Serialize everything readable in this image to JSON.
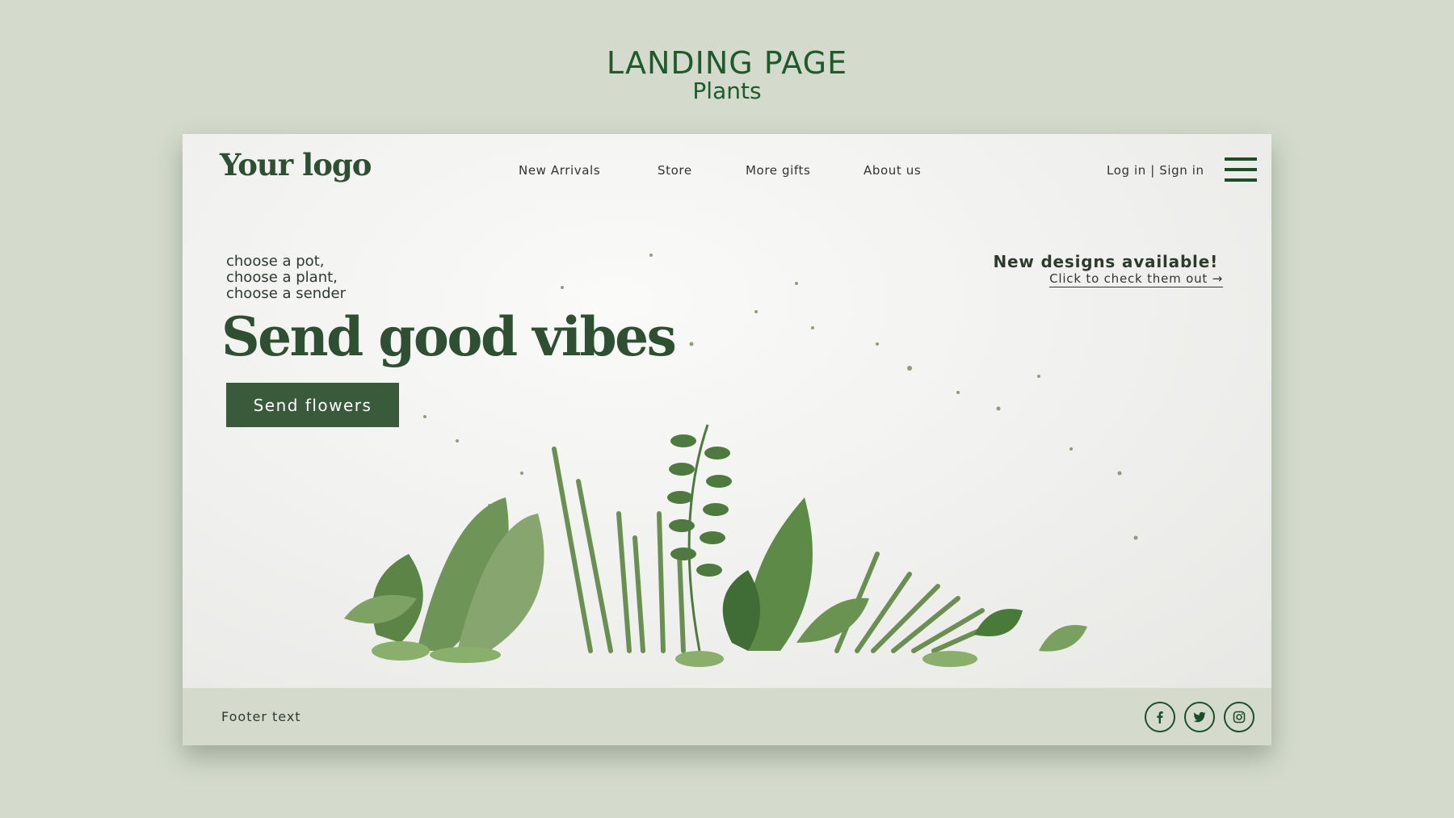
{
  "showcase": {
    "title": "LANDING PAGE",
    "subtitle": "Plants"
  },
  "header": {
    "logo": "Your logo",
    "nav": [
      "New Arrivals",
      "Store",
      "More gifts",
      "About us"
    ],
    "login": "Log in",
    "separator": " | ",
    "signin": "Sign in",
    "menu_icon": "hamburger-menu-icon"
  },
  "hero": {
    "tagline": [
      "choose a pot,",
      "choose a plant,",
      "choose a sender"
    ],
    "title": "Send good vibes",
    "cta": "Send flowers"
  },
  "promo": {
    "title": "New designs available!",
    "link": "Click to check them out →"
  },
  "footer": {
    "text": "Footer text",
    "social_icons": [
      "facebook-icon",
      "twitter-icon",
      "instagram-icon"
    ]
  },
  "colors": {
    "brand_green": "#2f4f33",
    "button_green": "#3a5a3c",
    "accent_green": "#1e5a2c",
    "page_background": "#d4dbcd"
  }
}
